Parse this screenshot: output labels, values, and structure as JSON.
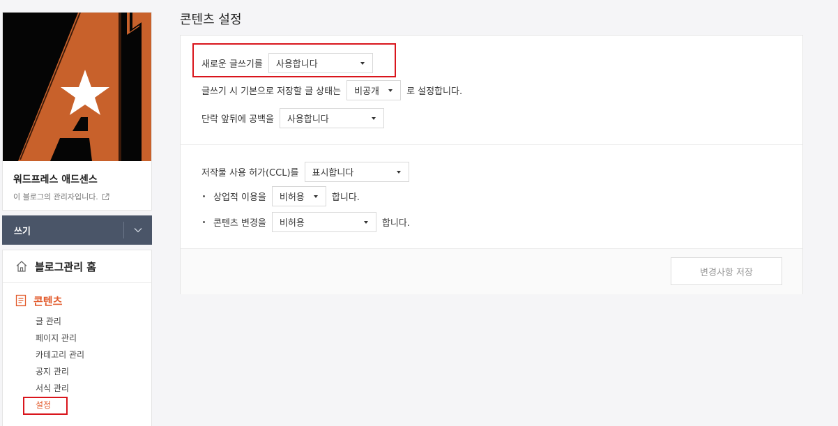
{
  "sidebar": {
    "blog_name": "워드프레스 애드센스",
    "blog_admin": "이 블로그의 관리자입니다.",
    "write_label": "쓰기",
    "menu": {
      "home_label": "블로그관리 홈",
      "contents_label": "콘텐츠",
      "sub_items": [
        "글 관리",
        "페이지 관리",
        "카테고리 관리",
        "공지 관리",
        "서식 관리",
        "설정"
      ]
    }
  },
  "page": {
    "title": "콘텐츠 설정"
  },
  "settings": {
    "new_editor": {
      "label": "새로운 글쓰기를",
      "value": "사용합니다"
    },
    "default_status": {
      "label": "글쓰기 시 기본으로 저장할 글 상태는",
      "value": "비공개",
      "after": "로 설정합니다."
    },
    "paragraph_spacing": {
      "label": "단락 앞뒤에 공백을",
      "value": "사용합니다"
    },
    "ccl": {
      "label": "저작물 사용 허가(CCL)를",
      "value": "표시합니다"
    },
    "commercial": {
      "label": "상업적 이용을",
      "value": "비허용",
      "after": "합니다."
    },
    "modification": {
      "label": "콘텐츠 변경을",
      "value": "비허용",
      "after": "합니다."
    }
  },
  "footer": {
    "save_label": "변경사항 저장"
  },
  "colors": {
    "accent": "#e25a2b",
    "highlight_box": "#d9151c",
    "write_bar": "#4a5568"
  }
}
